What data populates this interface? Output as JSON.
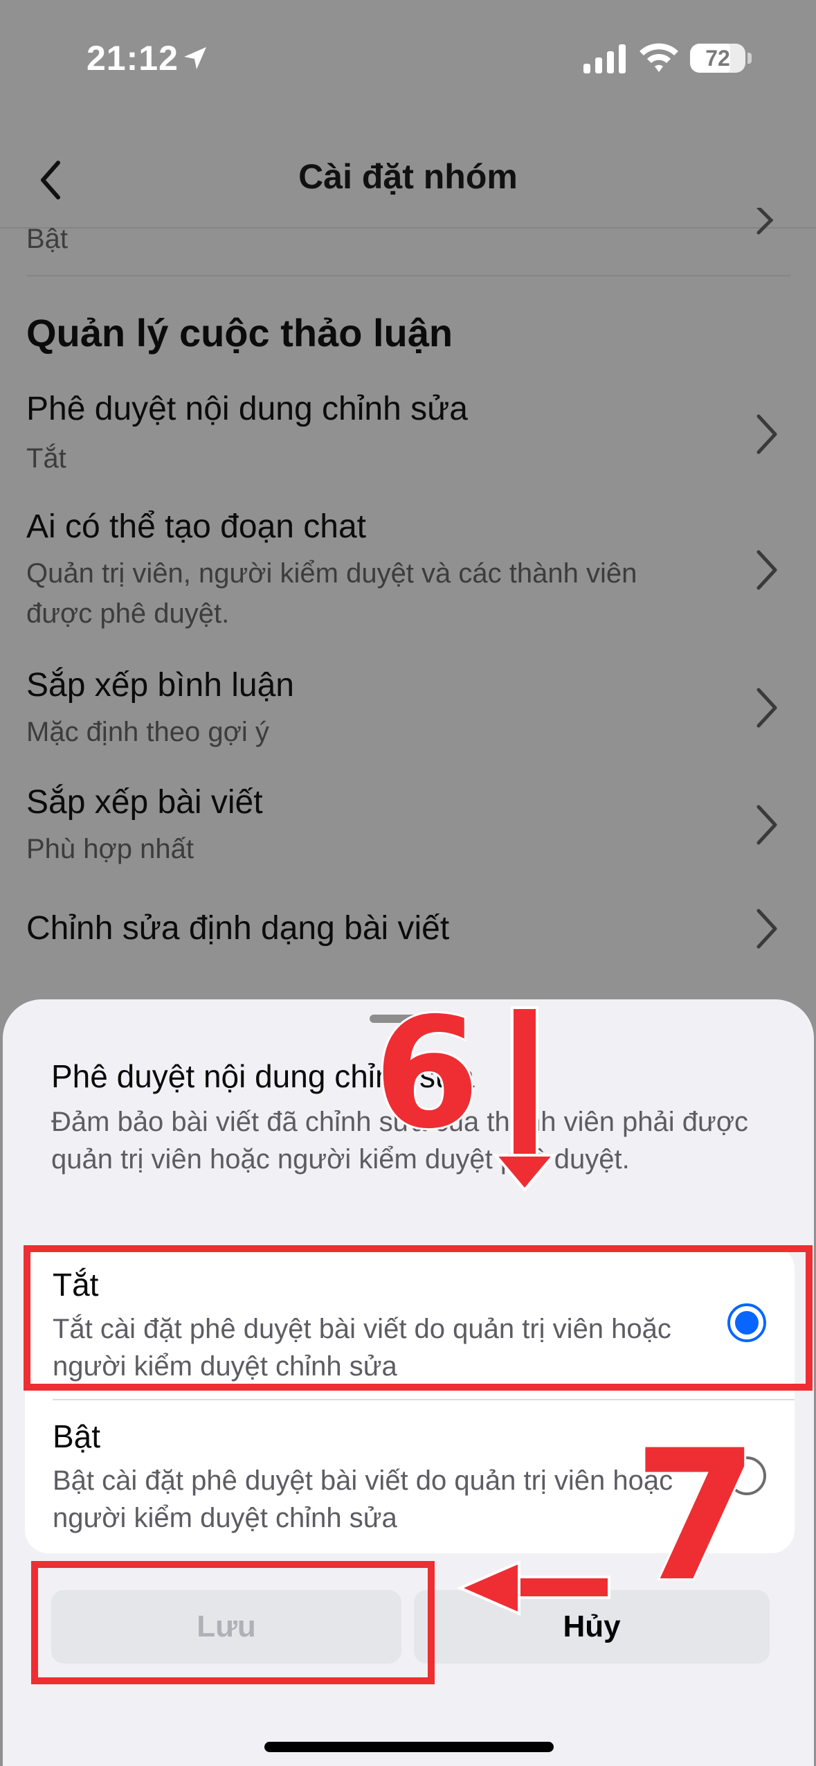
{
  "status_bar": {
    "time": "21:12",
    "battery": "72"
  },
  "nav": {
    "title": "Cài đặt nhóm"
  },
  "partial_row": {
    "subtitle": "Bật"
  },
  "section": {
    "heading": "Quản lý cuộc thảo luận"
  },
  "settings": [
    {
      "title": "Phê duyệt nội dung chỉnh sửa",
      "subtitle": "Tắt"
    },
    {
      "title": "Ai có thể tạo đoạn chat",
      "subtitle": "Quản trị viên, người kiểm duyệt và các thành viên được phê duyệt."
    },
    {
      "title": "Sắp xếp bình luận",
      "subtitle": "Mặc định theo gợi ý"
    },
    {
      "title": "Sắp xếp bài viết",
      "subtitle": "Phù hợp nhất"
    },
    {
      "title": "Chỉnh sửa định dạng bài viết",
      "subtitle": ""
    }
  ],
  "sheet": {
    "title": "Phê duyệt nội dung chỉnh sửa",
    "description": "Đảm bảo bài viết đã chỉnh sửa của thành viên phải được quản trị viên hoặc người kiểm duyệt phê duyệt.",
    "options": [
      {
        "title": "Tắt",
        "description": "Tắt cài đặt phê duyệt bài viết do quản trị viên hoặc người kiểm duyệt chỉnh sửa",
        "selected": true
      },
      {
        "title": "Bật",
        "description": "Bật cài đặt phê duyệt bài viết do quản trị viên hoặc người kiểm duyệt chỉnh sửa",
        "selected": false
      }
    ],
    "save_label": "Lưu",
    "cancel_label": "Hủy"
  },
  "annotations": {
    "step_6": "6",
    "step_7": "7",
    "color": "#ee2e33"
  },
  "colors": {
    "accent": "#0866ff",
    "overlay": "#919191",
    "annotation": "#ee2e33"
  }
}
